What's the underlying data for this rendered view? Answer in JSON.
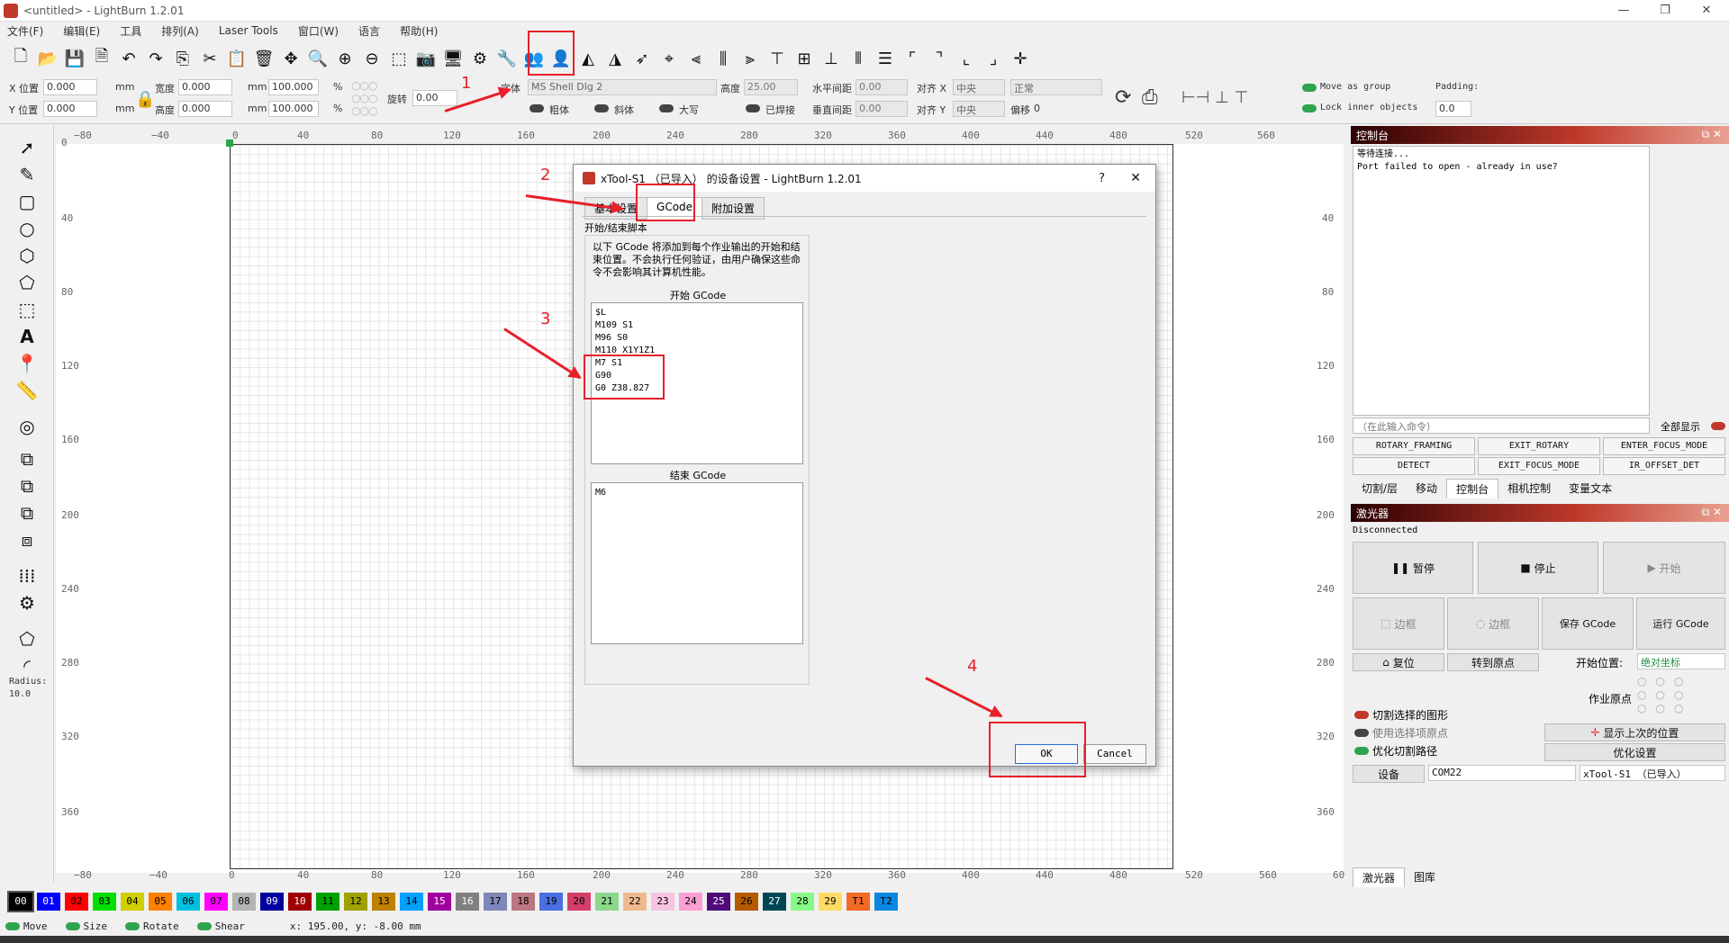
{
  "titlebar": {
    "title": "<untitled> - LightBurn 1.2.01",
    "min": "—",
    "max": "❐",
    "close": "✕"
  },
  "menu": [
    "文件(F)",
    "编辑(E)",
    "工具",
    "排列(A)",
    "Laser Tools",
    "窗口(W)",
    "语言",
    "帮助(H)"
  ],
  "props": {
    "x_label": "X 位置",
    "x_val": "0.000",
    "y_label": "Y 位置",
    "y_val": "0.000",
    "mm": "mm",
    "w_label": "宽度",
    "w_val": "0.000",
    "h_label": "高度",
    "h_val": "0.000",
    "pct1": "100.000",
    "pct2": "100.000",
    "pct": "%",
    "rot_label": "旋转",
    "rot_val": "0.00",
    "font_label": "字体",
    "font_val": "MS Shell Dlg 2",
    "height_label": "高度",
    "height_val": "25.00",
    "hspace_label": "水平间距",
    "hspace_val": "0.00",
    "vspace_label": "垂直间距",
    "vspace_val": "0.00",
    "alignx_label": "对齐 X",
    "alignx_val": "中央",
    "aligny_label": "对齐 Y",
    "aligny_val": "中央",
    "normal_val": "正常",
    "offset_label": "偏移",
    "offset_val": "0",
    "bold": "粗体",
    "italic": "斜体",
    "upper": "大写",
    "welded": "已焊接",
    "move_group": "Move as group",
    "lock_inner": "Lock inner objects",
    "padding_label": "Padding:",
    "padding_val": "0.0"
  },
  "ruler_top": [
    "0",
    "40",
    "80",
    "120",
    "160",
    "200",
    "240",
    "280",
    "320",
    "360",
    "400",
    "440",
    "480",
    "520",
    "560"
  ],
  "ruler_top_neg": "−80",
  "ruler_top_neg2": "−40",
  "ruler_left": [
    "0",
    "40",
    "80",
    "120",
    "160",
    "200",
    "240",
    "280",
    "320",
    "360"
  ],
  "ruler_right": [
    "40",
    "80",
    "120",
    "160",
    "200",
    "240",
    "280",
    "320",
    "360"
  ],
  "ruler_bottom": [
    "−80",
    "−40",
    "0",
    "40",
    "80",
    "120",
    "160",
    "200",
    "240",
    "280",
    "320",
    "360",
    "400",
    "440",
    "480",
    "520",
    "560",
    "60"
  ],
  "left_tools": {
    "radius_label": "Radius:",
    "radius_val": "10.0"
  },
  "console": {
    "title": "控制台",
    "lines": [
      "等待连接...",
      "Port failed to open - already in use?"
    ],
    "placeholder": "（在此输入命令）",
    "show_all": "全部显示",
    "macros": [
      "ROTARY_FRAMING",
      "EXIT_ROTARY",
      "ENTER_FOCUS_MODE",
      "DETECT",
      "EXIT_FOCUS_MODE",
      "IR_OFFSET_DET"
    ],
    "tabs": [
      "切割/层",
      "移动",
      "控制台",
      "相机控制",
      "变量文本"
    ]
  },
  "laser": {
    "title": "激光器",
    "status": "Disconnected",
    "pause": "暂停",
    "stop": "停止",
    "start": "开始",
    "frame1": "边框",
    "frame2": "边框",
    "save_gcode": "保存 GCode",
    "run_gcode": "运行 GCode",
    "home": "复位",
    "goto_origin": "转到原点",
    "start_from": "开始位置:",
    "start_from_val": "绝对坐标",
    "job_origin": "作业原点",
    "cut_selected": "切割选择的图形",
    "use_sel_origin": "使用选择项原点",
    "optimize_path": "优化切割路径",
    "show_last": "显示上次的位置",
    "optimize_settings": "优化设置",
    "devices": "设备",
    "port": "COM22",
    "device": "xTool-S1 （已导入）",
    "tabs": [
      "激光器",
      "图库"
    ]
  },
  "palette": [
    "00",
    "01",
    "02",
    "03",
    "04",
    "05",
    "06",
    "07",
    "08",
    "09",
    "10",
    "11",
    "12",
    "13",
    "14",
    "15",
    "16",
    "17",
    "18",
    "19",
    "20",
    "21",
    "22",
    "23",
    "24",
    "25",
    "26",
    "27",
    "28",
    "29",
    "T1",
    "T2"
  ],
  "palette_colors": [
    "#000000",
    "#0000ff",
    "#ff0000",
    "#00e000",
    "#d0d000",
    "#ff8000",
    "#00c0e0",
    "#ff00ff",
    "#b4b4b4",
    "#0000a0",
    "#a00000",
    "#00a000",
    "#a0a000",
    "#c08000",
    "#00a0ff",
    "#a000a0",
    "#808080",
    "#7d87b9",
    "#bb7784",
    "#4a6fe3",
    "#d33f6a",
    "#8cd78c",
    "#f0b98d",
    "#f6c4e1",
    "#fa9ed4",
    "#500a78",
    "#b45a00",
    "#004754",
    "#86fa88",
    "#ffdb66",
    "#f36926",
    "#0a87e0"
  ],
  "status": {
    "move": "Move",
    "size": "Size",
    "rotate": "Rotate",
    "shear": "Shear",
    "coords": "x: 195.00, y: -8.00 mm"
  },
  "dialog": {
    "title": "xTool-S1 （已导入） 的设备设置 - LightBurn 1.2.01",
    "help": "?",
    "close": "✕",
    "tabs": [
      "基本设置",
      "GCode",
      "附加设置"
    ],
    "section": "开始/结束脚本",
    "desc": "以下 GCode 将添加到每个作业输出的开始和结束位置。不会执行任何验证，由用户确保这些命令不会影响其计算机性能。",
    "start_label": "开始 GCode",
    "start_code": "$L\nM109 S1\nM96 S0\nM110 X1Y1Z1\nM7 S1\nG90\nG0 Z38.827",
    "end_label": "结束 GCode",
    "end_code": "M6",
    "ok": "OK",
    "cancel": "Cancel"
  },
  "annotations": [
    "1",
    "2",
    "3",
    "4"
  ]
}
